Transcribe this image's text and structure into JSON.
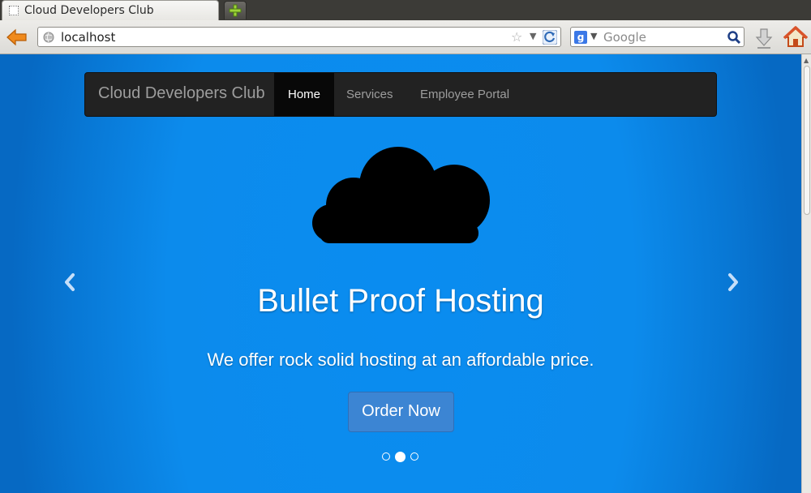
{
  "browser": {
    "tab_title": "Cloud Developers Club",
    "url": "localhost",
    "search_placeholder": "Google",
    "search_engine_icon": "google-g-icon"
  },
  "site": {
    "brand": "Cloud Developers Club",
    "nav": [
      {
        "label": "Home",
        "active": true
      },
      {
        "label": "Services",
        "active": false
      },
      {
        "label": "Employee Portal",
        "active": false
      }
    ]
  },
  "carousel": {
    "image_icon": "cloud-icon",
    "headline": "Bullet Proof Hosting",
    "subline": "We offer rock solid hosting at an affordable price.",
    "cta": "Order Now",
    "slide_count": 3,
    "active_slide": 2,
    "prev_icon": "chevron-left-icon",
    "next_icon": "chevron-right-icon"
  },
  "colors": {
    "background_blue": "#0a8cf0",
    "navbar_dark": "#222222",
    "cta_blue": "#3c85d3"
  }
}
